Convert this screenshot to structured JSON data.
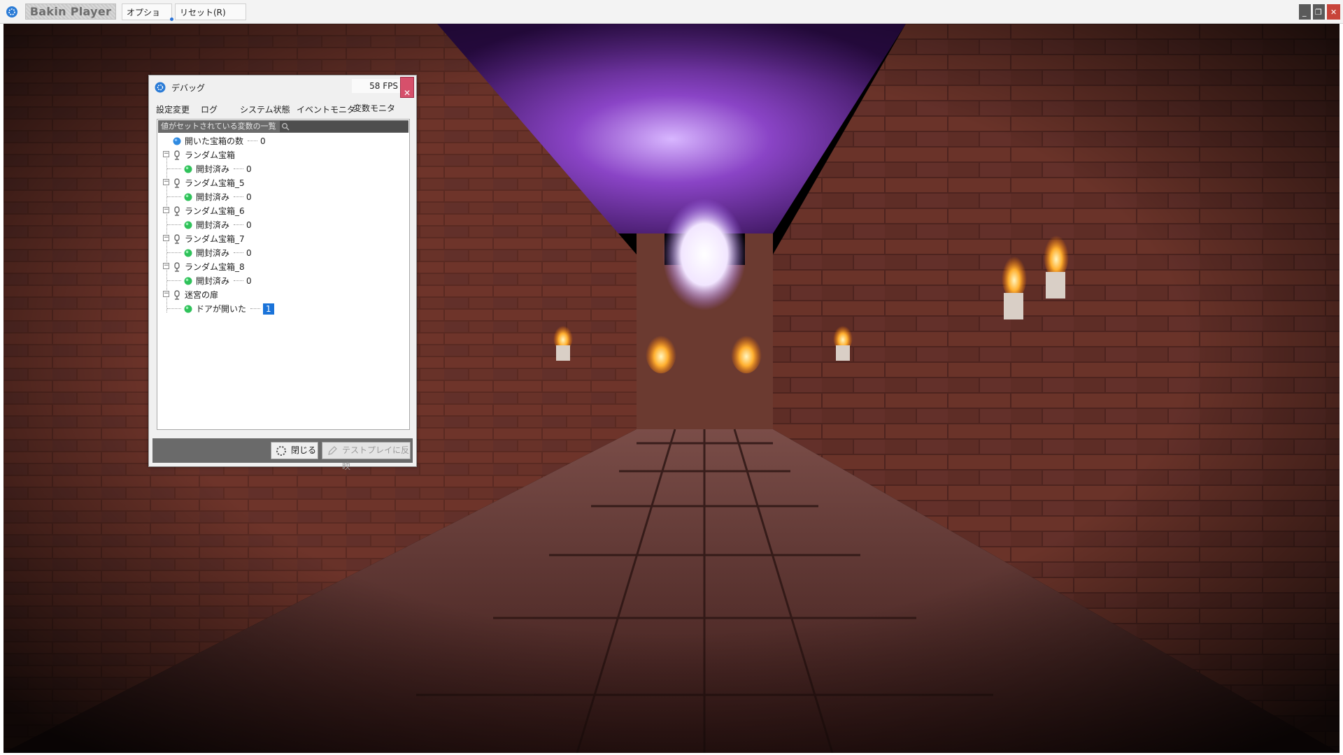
{
  "titlebar": {
    "app_title": "Bakin Player",
    "menu_options": "オプション(O)",
    "menu_reset": "リセット(R) Ctrl+C"
  },
  "debug": {
    "title": "デバッグ",
    "fps": "58 FPS",
    "tabs": [
      "設定変更",
      "ログ",
      "システム状態",
      "イベントモニタ",
      "変数モニタ"
    ],
    "active_tab": "変数モニタ",
    "list_header": "値がセットされている変数の一覧",
    "tree": [
      {
        "label": "開いた宝箱の数",
        "value": "0"
      },
      {
        "label": "ランダム宝箱"
      },
      {
        "label": "開封済み",
        "value": "0"
      },
      {
        "label": "ランダム宝箱_5"
      },
      {
        "label": "開封済み",
        "value": "0"
      },
      {
        "label": "ランダム宝箱_6"
      },
      {
        "label": "開封済み",
        "value": "0"
      },
      {
        "label": "ランダム宝箱_7"
      },
      {
        "label": "開封済み",
        "value": "0"
      },
      {
        "label": "ランダム宝箱_8"
      },
      {
        "label": "開封済み",
        "value": "0"
      },
      {
        "label": "迷宮の扉"
      },
      {
        "label": "ドアが開いた",
        "value": "1"
      }
    ],
    "close_button": "閉じる",
    "apply_button": "テストプレイに反映"
  },
  "colors": {
    "accent": "#1a73d9",
    "close_red": "#d6506b",
    "sky_purple": "#7a38b8"
  }
}
